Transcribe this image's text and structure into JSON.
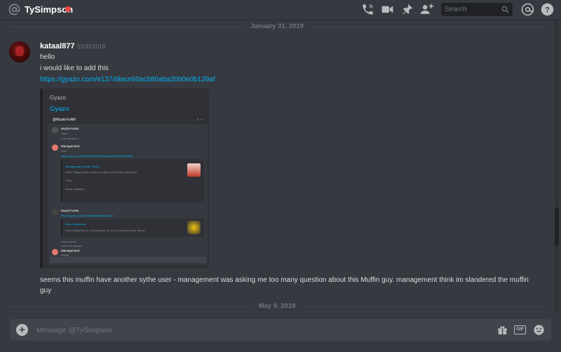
{
  "header": {
    "dm_name": "TySimpson",
    "status_color": "#f04747",
    "search_placeholder": "Search",
    "icons": [
      "at-icon",
      "call-icon",
      "video-icon",
      "pin-icon",
      "add-friend-icon",
      "search-icon",
      "mentions-icon",
      "help-icon"
    ]
  },
  "dividers": {
    "first_date": "January 31, 2019",
    "second_date": "May 9, 2019"
  },
  "message": {
    "author": "kataal877",
    "timestamp": "01/31/2019",
    "lines": [
      "hello",
      "i would like to add this"
    ],
    "link": "https://gyazo.com/e13749ace60acb80aba20b0e0b139af",
    "embed": {
      "provider": "Gyazo",
      "title": "Gyazo",
      "screenshot": {
        "channel": "@Muzki-FuNN",
        "entries": [
          {
            "name": "Muzki-FuNN",
            "text": [
              "Hello",
              "I can doubt u?"
            ]
          },
          {
            "name": "Management",
            "text": [
              "Sure"
            ],
            "link": "https://gyazo.com/4f46a7ee0a02e3a9a2d19b30e0e9a4a3",
            "embed_title": "Management Insider Player",
            "embed_text": [
              "Hello! Please place a report of any and all Ruby violations",
              "There",
              "Wrote mistakes"
            ]
          },
          {
            "name": "Muzki-FuNN",
            "link": "https://gyazo.com/4f7a3b6e3e9a2f4a5c1e",
            "embed_title": "Rune Avalanche",
            "embed_text": [
              "Rune Avalanche is a Runescape at Gold & Private Game Server"
            ]
          },
          {
            "name": "Management",
            "text": [
              "Alright"
            ]
          }
        ],
        "extra": [
          "Rarely more",
          "much not please"
        ]
      }
    },
    "followup": "seems this muffin have another sythe user - management was asking me too many question about this Muffin guy. management think im slandered the muffin guy"
  },
  "composer": {
    "placeholder": "Message @TySimpson",
    "icons": [
      "attach-plus-icon",
      "gift-icon",
      "gif-icon",
      "emoji-icon"
    ],
    "gif_label": "GIF"
  }
}
